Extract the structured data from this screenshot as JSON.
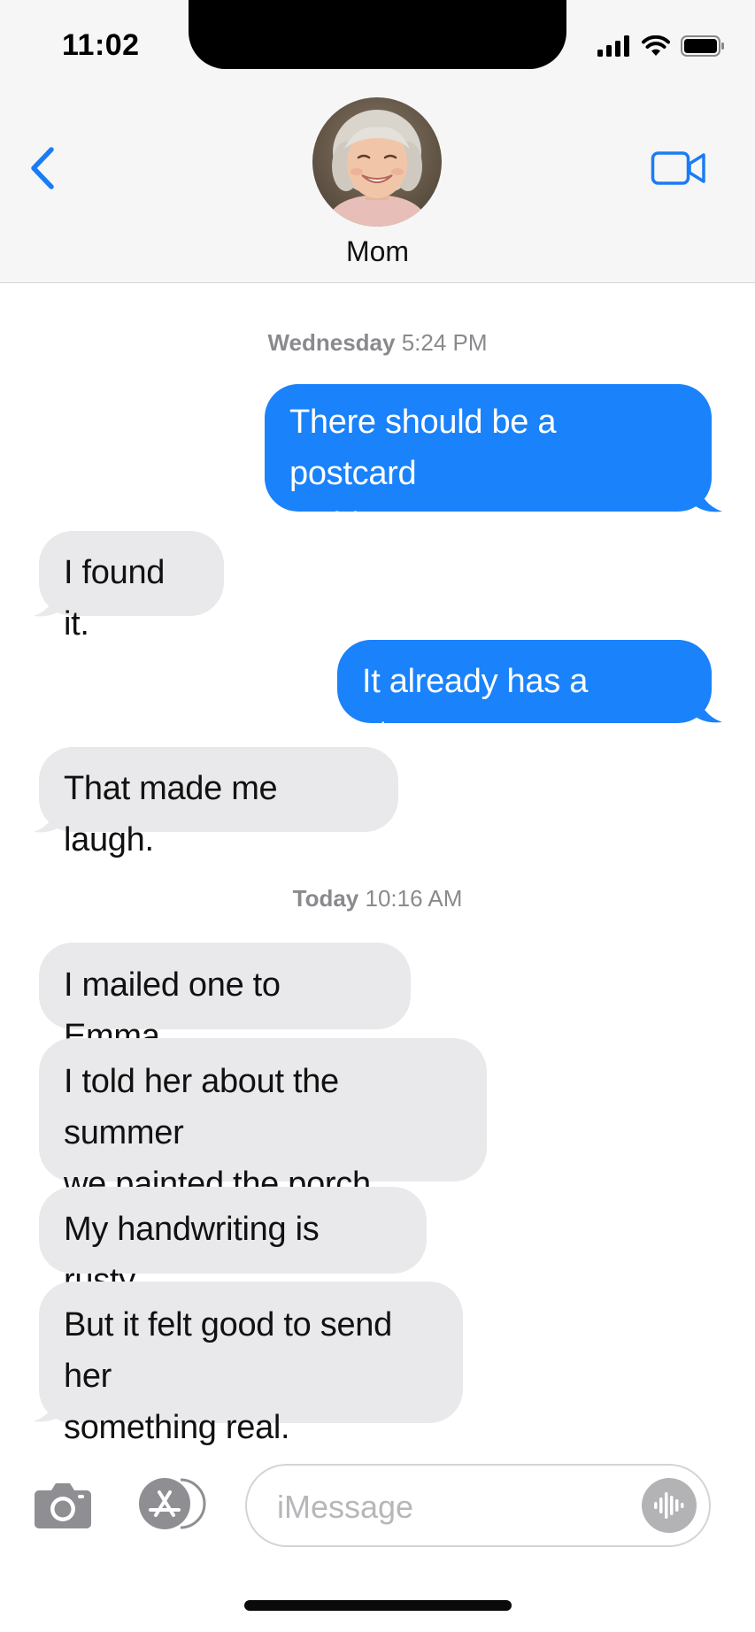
{
  "status_bar": {
    "time": "11:02",
    "icons": [
      "cellular-signal-icon",
      "wifi-icon",
      "battery-icon"
    ]
  },
  "header": {
    "back_icon": "chevron-left-icon",
    "contact_name": "Mom",
    "video_icon": "video-camera-icon"
  },
  "conversation": {
    "timestamp_1": {
      "day": "Wednesday",
      "time": "5:24 PM"
    },
    "timestamp_2": {
      "day": "Today",
      "time": "10:16 AM"
    },
    "messages": [
      {
        "direction": "outgoing",
        "lines": [
          "There should be a postcard",
          "in this one."
        ]
      },
      {
        "direction": "incoming",
        "lines": [
          "I found it."
        ]
      },
      {
        "direction": "outgoing",
        "lines": [
          "It already has a stamp."
        ]
      },
      {
        "direction": "incoming",
        "lines": [
          "That made me laugh."
        ]
      },
      {
        "direction": "incoming",
        "lines": [
          "I mailed one to Emma."
        ]
      },
      {
        "direction": "incoming",
        "lines": [
          "I told her about the summer",
          "we painted the porch."
        ]
      },
      {
        "direction": "incoming",
        "lines": [
          "My handwriting is rusty."
        ]
      },
      {
        "direction": "incoming",
        "lines": [
          "But it felt good to send her",
          "something real."
        ]
      }
    ]
  },
  "input_bar": {
    "camera_icon": "camera-icon",
    "apps_icon": "app-store-icon",
    "placeholder": "iMessage",
    "audio_icon": "audio-waveform-icon"
  },
  "colors": {
    "outgoing_bubble": "#1a82fb",
    "incoming_bubble": "#e9e9eb",
    "accent": "#1a7cf5",
    "header_bg": "#f6f6f6"
  }
}
